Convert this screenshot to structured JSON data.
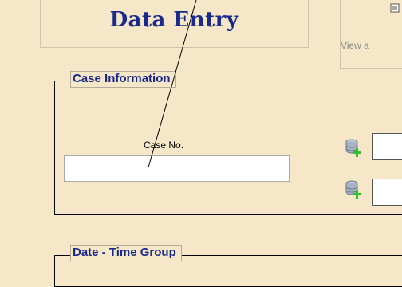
{
  "form": {
    "title": "Data Entry"
  },
  "view_panel": {
    "text": "View a",
    "icon": "document-icon"
  },
  "case_info": {
    "legend": "Case Information",
    "case_no_label": "Case No.",
    "case_no_value": "",
    "db_add_icon": "database-add-icon"
  },
  "date_time": {
    "legend": "Date - Time Group"
  },
  "colors": {
    "background": "#f6e7c8",
    "legend_text": "#1a2a8c",
    "title_text": "#1a2a8c"
  }
}
